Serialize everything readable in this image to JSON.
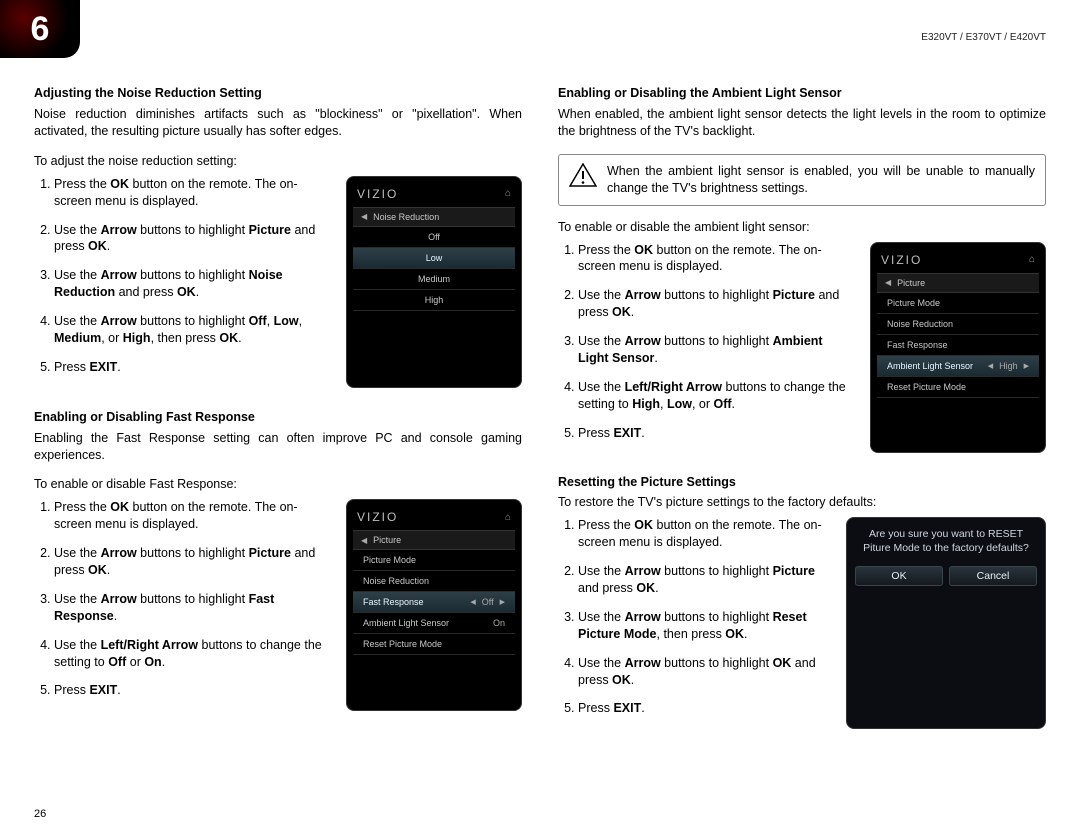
{
  "header": {
    "chapter": "6",
    "models": "E320VT / E370VT / E420VT"
  },
  "page_number": "26",
  "left": {
    "s1": {
      "title": "Adjusting the Noise Reduction Setting",
      "intro": "Noise reduction diminishes artifacts such as \"blockiness\" or \"pixellation\". When activated, the resulting picture usually has softer edges.",
      "lead": "To adjust the noise reduction setting:",
      "steps": {
        "a1": "Press the ",
        "a2": "OK",
        "a3": " button on the remote. The on-screen menu is displayed.",
        "b1": "Use the ",
        "b2": "Arrow",
        "b3": " buttons to highlight ",
        "b4": "Picture",
        "b5": " and press ",
        "b6": "OK",
        "b7": ".",
        "c1": "Use the ",
        "c2": "Arrow",
        "c3": " buttons to highlight ",
        "c4": "Noise Reduction",
        "c5": " and press ",
        "c6": "OK",
        "c7": ".",
        "d1": "Use the ",
        "d2": "Arrow",
        "d3": " buttons to highlight ",
        "d4": "Off",
        "d5": ", ",
        "d6": "Low",
        "d7": ", ",
        "d8": "Medium",
        "d9": ", or ",
        "d10": "High",
        "d11": ", then press ",
        "d12": "OK",
        "d13": ".",
        "e1": "Press ",
        "e2": "EXIT",
        "e3": "."
      },
      "fig": {
        "logo": "VIZIO",
        "crumb": "Noise Reduction",
        "r1": "Off",
        "r2": "Low",
        "r3": "Medium",
        "r4": "High"
      }
    },
    "s2": {
      "title": "Enabling or Disabling Fast Response",
      "intro": "Enabling the Fast Response setting can often improve PC and console gaming experiences.",
      "lead": "To enable or disable Fast Response:",
      "steps": {
        "a1": "Press the ",
        "a2": "OK",
        "a3": " button on the remote. The on-screen menu is displayed.",
        "b1": "Use the ",
        "b2": "Arrow",
        "b3": " buttons to highlight ",
        "b4": "Picture",
        "b5": " and press ",
        "b6": "OK",
        "b7": ".",
        "c1": "Use the ",
        "c2": "Arrow",
        "c3": " buttons to highlight ",
        "c4": "Fast Response",
        "c5": ".",
        "d1": "Use the ",
        "d2": "Left/Right Arrow",
        "d3": " buttons to change the setting to ",
        "d4": "Off",
        "d5": " or ",
        "d6": "On",
        "d7": ".",
        "e1": "Press ",
        "e2": "EXIT",
        "e3": "."
      },
      "fig": {
        "logo": "VIZIO",
        "crumb": "Picture",
        "r1": "Picture Mode",
        "r2": "Noise Reduction",
        "r3": "Fast Response",
        "r3v": "Off",
        "r4": "Ambient Light Sensor",
        "r4v": "On",
        "r5": "Reset Picture Mode"
      }
    }
  },
  "right": {
    "s1": {
      "title": "Enabling or Disabling the Ambient Light Sensor",
      "intro": "When enabled, the ambient light sensor detects the light levels in the room to optimize the brightness of the TV's backlight.",
      "warn": "When the ambient light sensor is enabled, you will be unable to manually change the TV's brightness settings.",
      "lead": "To enable or disable the ambient light sensor:",
      "steps": {
        "a1": "Press the ",
        "a2": "OK",
        "a3": " button on the remote. The on-screen menu is displayed.",
        "b1": "Use the ",
        "b2": "Arrow",
        "b3": " buttons to highlight ",
        "b4": "Picture",
        "b5": " and press ",
        "b6": "OK",
        "b7": ".",
        "c1": "Use the ",
        "c2": "Arrow",
        "c3": " buttons to highlight ",
        "c4": "Ambient Light Sensor",
        "c5": ".",
        "d1": "Use the ",
        "d2": "Left/Right Arrow",
        "d3": " buttons to change the setting to ",
        "d4": "High",
        "d5": ", ",
        "d6": "Low",
        "d7": ", or ",
        "d8": "Off",
        "d9": ".",
        "e1": "Press ",
        "e2": "EXIT",
        "e3": "."
      },
      "fig": {
        "logo": "VIZIO",
        "crumb": "Picture",
        "r1": "Picture Mode",
        "r2": "Noise Reduction",
        "r3": "Fast Response",
        "r4": "Ambient Light Sensor",
        "r4v": "High",
        "r5": "Reset Picture Mode"
      }
    },
    "s2": {
      "title": "Resetting the Picture Settings",
      "lead": "To restore the TV's picture settings to the factory defaults:",
      "steps": {
        "a1": "Press the ",
        "a2": "OK",
        "a3": " button on the remote. The on-screen menu is displayed.",
        "b1": "Use the ",
        "b2": "Arrow",
        "b3": " buttons to highlight ",
        "b4": "Picture",
        "b5": " and press ",
        "b6": "OK",
        "b7": ".",
        "c1": "Use the ",
        "c2": "Arrow",
        "c3": " buttons to highlight ",
        "c4": "Reset Picture Mode",
        "c5": ", then press ",
        "c6": "OK",
        "c7": ".",
        "d1": "Use the ",
        "d2": "Arrow",
        "d3": " buttons to highlight ",
        "d4": "OK",
        "d5": " and press ",
        "d6": "OK",
        "d7": ".",
        "e1": "Press ",
        "e2": "EXIT",
        "e3": "."
      },
      "dialog": {
        "msg": "Are you sure you want to RESET Piture Mode to the factory defaults?",
        "ok": "OK",
        "cancel": "Cancel"
      }
    }
  }
}
